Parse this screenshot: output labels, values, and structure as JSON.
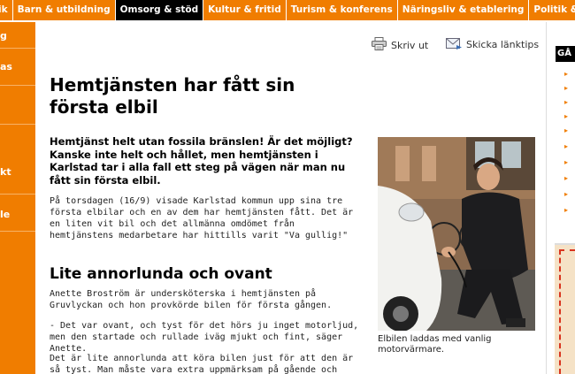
{
  "top_nav": {
    "items": [
      {
        "label": "ik"
      },
      {
        "label": "Barn & utbildning"
      },
      {
        "label": "Omsorg & stöd",
        "active": true
      },
      {
        "label": "Kultur & fritid"
      },
      {
        "label": "Turism & konferens"
      },
      {
        "label": "Näringsliv & etablering"
      },
      {
        "label": "Politik & påv"
      }
    ]
  },
  "left_nav": {
    "items": [
      {
        "label": "g"
      },
      {
        "label": "as"
      },
      {
        "label": "kt"
      },
      {
        "label": "le"
      }
    ]
  },
  "tools": {
    "print_label": "Skriv ut",
    "send_link_label": "Skicka länktips",
    "print_icon": "printer-icon",
    "send_icon": "envelope-icon"
  },
  "article": {
    "title": "Hemtjänsten har fått sin första elbil",
    "lead": "Hemtjänst helt utan fossila bränslen! Är det möjligt? Kanske inte helt och hållet, men hemtjänsten i Karlstad tar i alla fall ett steg på vägen när man nu fått sin första elbil.",
    "para1": "På torsdagen (16/9) visade Karlstad kommun upp sina tre första elbilar och en av dem har hemtjänsten fått. Det är en liten vit bil och det allmänna omdömet från hemtjänstens medarbetare har hittills varit \"Va gullig!\"",
    "subheading": "Lite annorlunda och ovant",
    "para2": "Anette Broström är undersköterska i hemtjänsten på Gruvlyckan och hon provkörde bilen för första gången.",
    "para3": "- Det var ovant, och tyst för det hörs ju inget motorljud, men den startade och rullade iväg mjukt och fint, säger Anette.",
    "para4": "Det är lite annorlunda att köra bilen just för att den är så tyst. Man måste vara extra uppmärksam på gående och cyklister"
  },
  "photo": {
    "caption": "Elbilen laddas med vanlig motorvärmare."
  },
  "right_column": {
    "header": "GÅ"
  },
  "colors": {
    "brand_orange": "#f07d00",
    "active_tab": "#000000"
  }
}
